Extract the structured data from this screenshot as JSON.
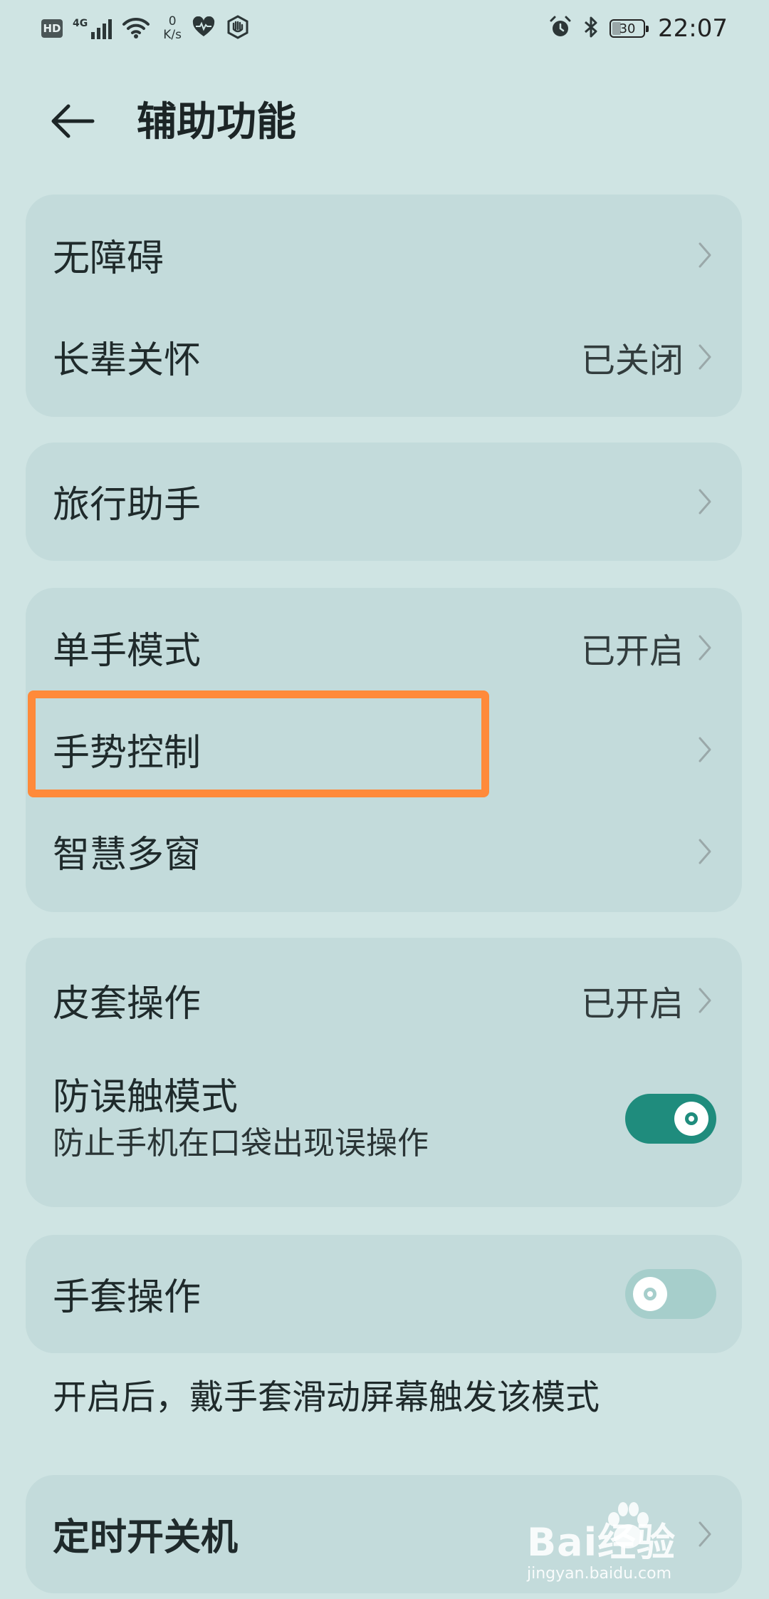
{
  "status_bar": {
    "hd": "HD",
    "network": "4G",
    "speed_value": "0",
    "speed_unit": "K/s",
    "battery_level": "30",
    "time": "22:07"
  },
  "header": {
    "title": "辅助功能"
  },
  "groups": [
    {
      "items": [
        {
          "label": "无障碍",
          "value": ""
        },
        {
          "label": "长辈关怀",
          "value": "已关闭"
        }
      ]
    },
    {
      "items": [
        {
          "label": "旅行助手",
          "value": ""
        }
      ]
    },
    {
      "items": [
        {
          "label": "单手模式",
          "value": "已开启"
        },
        {
          "label": "手势控制",
          "value": ""
        },
        {
          "label": "智慧多窗",
          "value": ""
        }
      ]
    },
    {
      "items": [
        {
          "label": "皮套操作",
          "value": "已开启"
        }
      ],
      "toggle_item": {
        "label": "防误触模式",
        "subtitle": "防止手机在口袋出现误操作",
        "state": "on"
      }
    },
    {
      "toggle_item": {
        "label": "手套操作",
        "state": "off"
      }
    }
  ],
  "glove_note": "开启后，戴手套滑动屏幕触发该模式",
  "last_group": {
    "items": [
      {
        "label": "定时开关机",
        "value": ""
      }
    ]
  },
  "watermark": {
    "brand": "Bai经验",
    "site": "jingyan.baidu.com"
  },
  "colors": {
    "background": "#cfe4e3",
    "card": "#c3dbdb",
    "toggle_on": "#1f8c7d",
    "toggle_off": "#a6cecb",
    "highlight": "#ff8a3a"
  }
}
